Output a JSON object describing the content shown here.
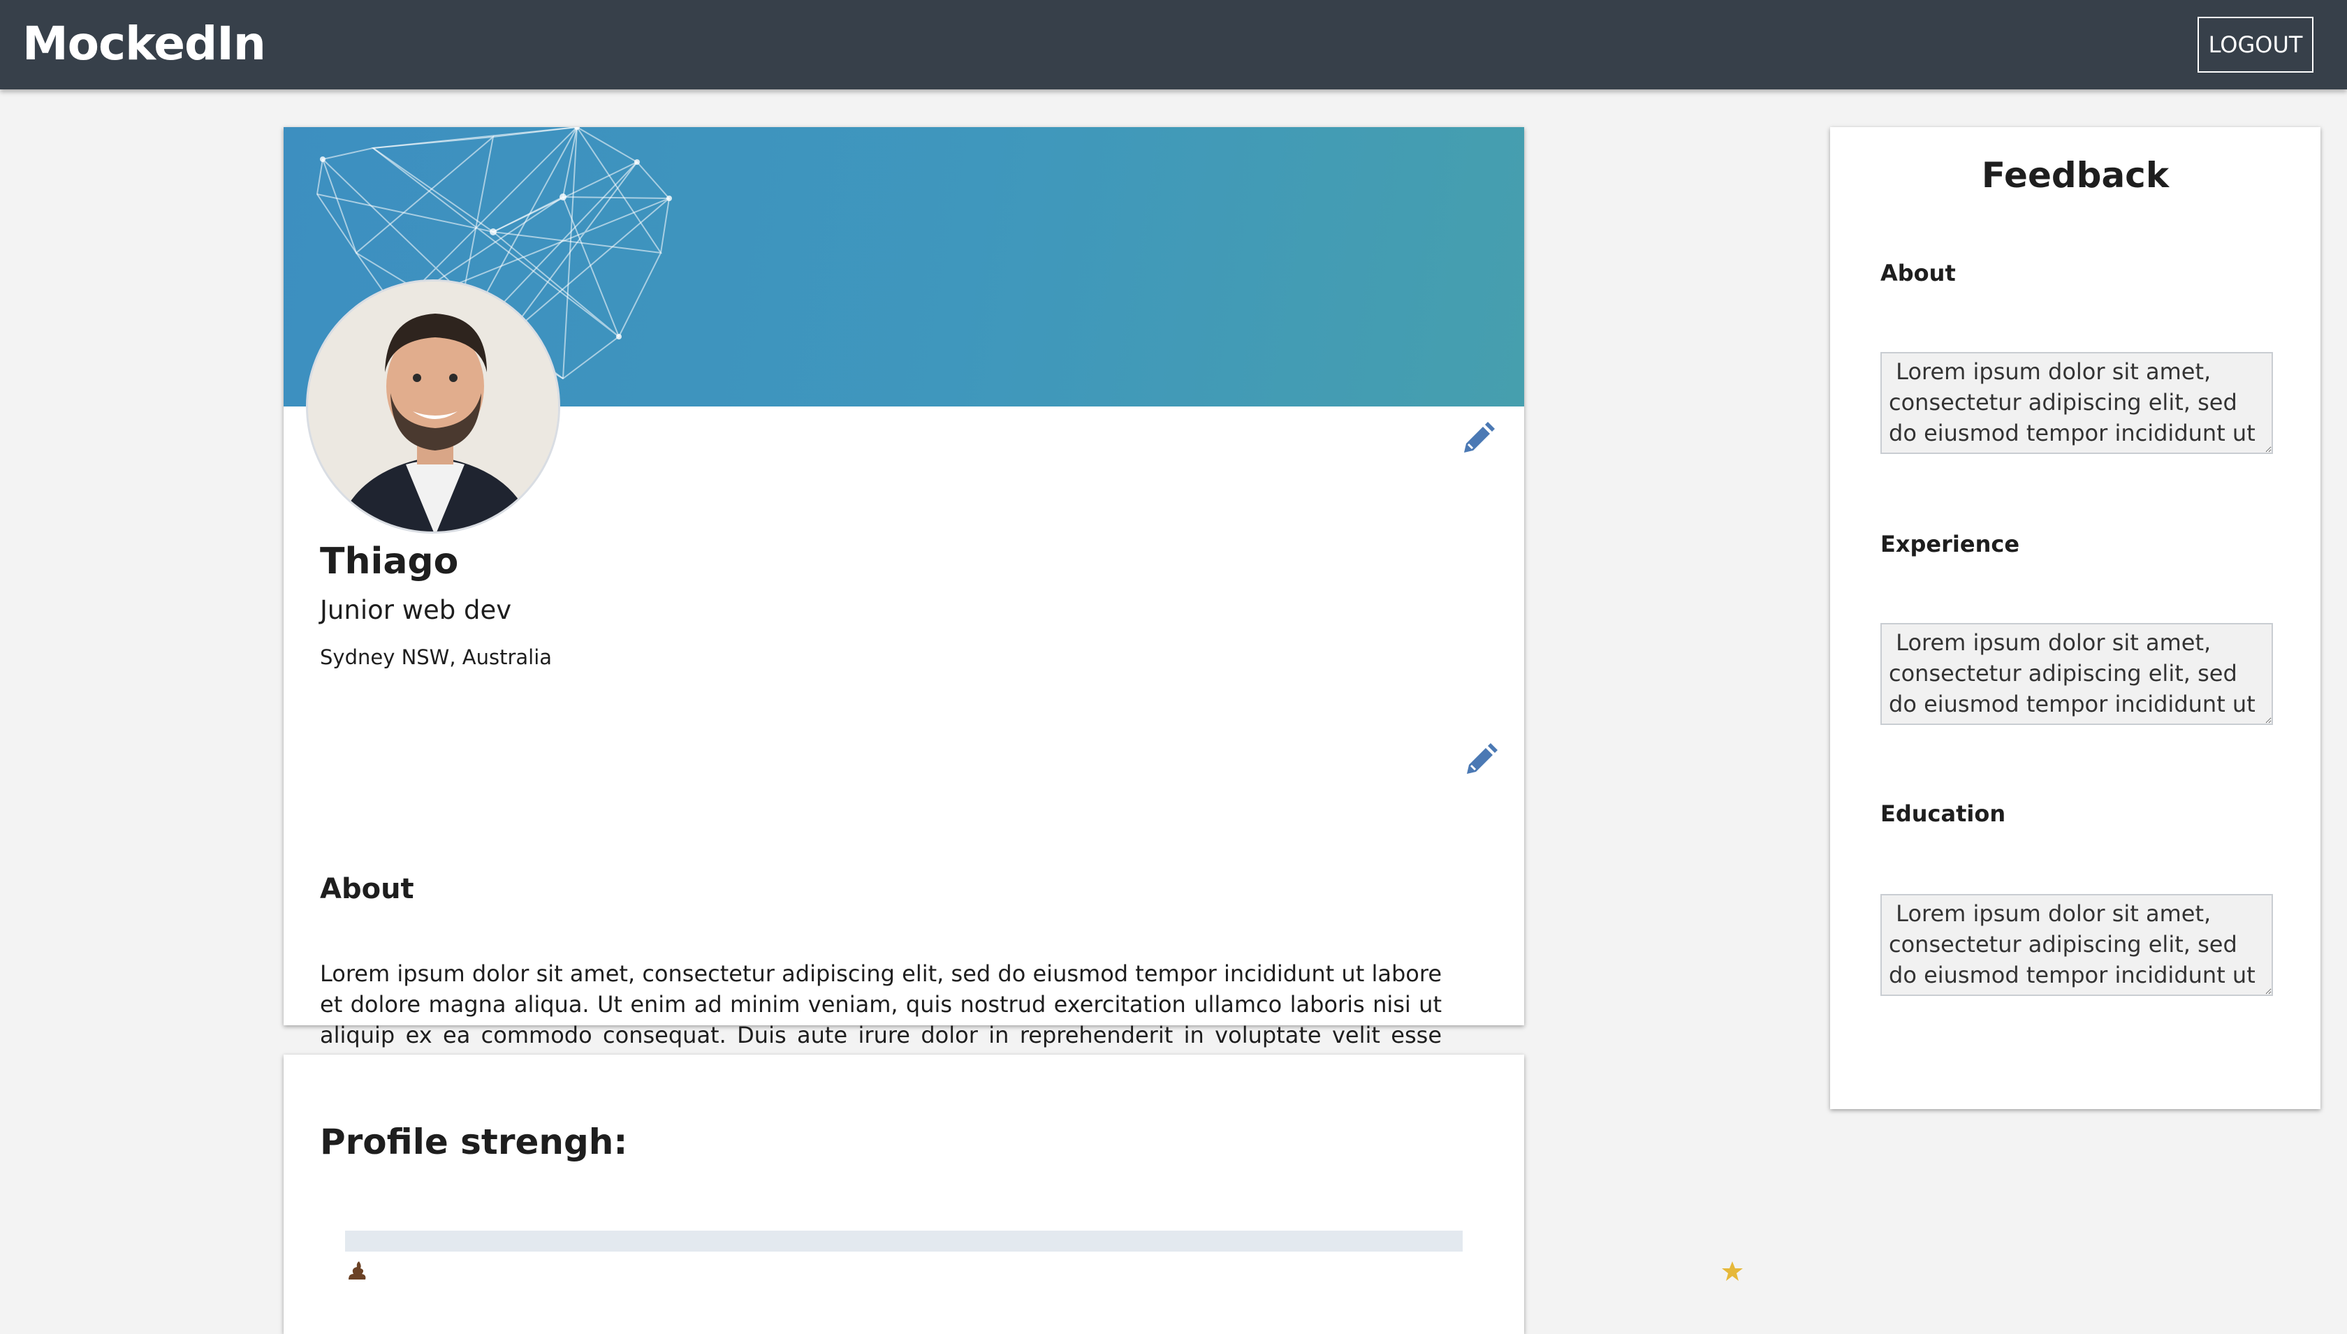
{
  "app": {
    "title": "MockedIn"
  },
  "header": {
    "logout_label": "LOGOUT"
  },
  "profile": {
    "name": "Thiago",
    "headline": "Junior web dev",
    "location": "Sydney NSW, Australia",
    "about_title": "About",
    "about_text": "Lorem ipsum dolor sit amet, consectetur adipiscing elit, sed do eiusmod tempor incididunt ut labore et dolore magna aliqua. Ut enim ad minim veniam, quis nostrud exercitation ullamco laboris nisi ut aliquip ex ea commodo consequat. Duis aute irure dolor in reprehenderit in voluptate velit esse cillum dolore eu fugiat nulla pariatur. Excepteur sint occaecat cupidatat non proident, sunt in culpa qui officia deserunt mollit anim id est laborum."
  },
  "strength": {
    "title": "Profile strengh:",
    "progress": 0,
    "low_icon": "poop-icon",
    "high_icon": "star-icon"
  },
  "feedback": {
    "title": "Feedback",
    "sections": [
      {
        "label": "About",
        "value": " Lorem ipsum dolor sit amet, consectetur adipiscing elit, sed do eiusmod tempor incididunt ut"
      },
      {
        "label": "Experience",
        "value": " Lorem ipsum dolor sit amet, consectetur adipiscing elit, sed do eiusmod tempor incididunt ut"
      },
      {
        "label": "Education",
        "value": " Lorem ipsum dolor sit amet, consectetur adipiscing elit, sed do eiusmod tempor incididunt ut"
      }
    ]
  },
  "colors": {
    "topbar": "#37404a",
    "banner": "#3f93bf",
    "edit_icon": "#4b79b4",
    "progress_track": "#e3e9ef",
    "star": "#e6b83a"
  }
}
